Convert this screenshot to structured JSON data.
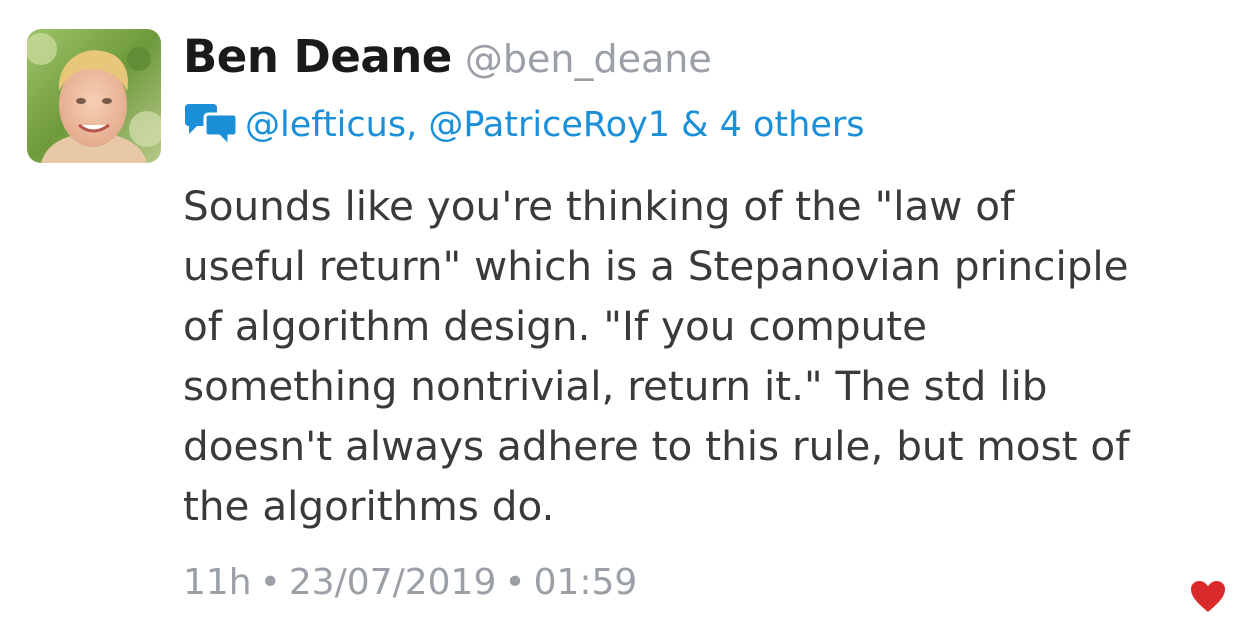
{
  "tweet": {
    "author_name": "Ben Deane",
    "author_handle": "@ben_deane",
    "reply_to": "@lefticus, @PatriceRoy1 & 4 others",
    "body_lines": [
      "Sounds like you're thinking of the \"law of",
      "useful return\" which is a Stepanovian principle",
      "of algorithm design. \"If you compute",
      "something nontrivial, return it.\" The std lib",
      "doesn't always adhere to this rule, but most of",
      "the algorithms do."
    ],
    "relative_time": "11h",
    "separator": "•",
    "date": "23/07/2019",
    "time": "01:59"
  },
  "icons": {
    "avatar": "avatar",
    "reply": "conversation-icon",
    "like": "heart-icon"
  },
  "colors": {
    "name": "#1a1a1a",
    "muted": "#9aa0a6",
    "link": "#1b8fd8",
    "body": "#3a3a3a",
    "heart": "#d92b2b"
  }
}
